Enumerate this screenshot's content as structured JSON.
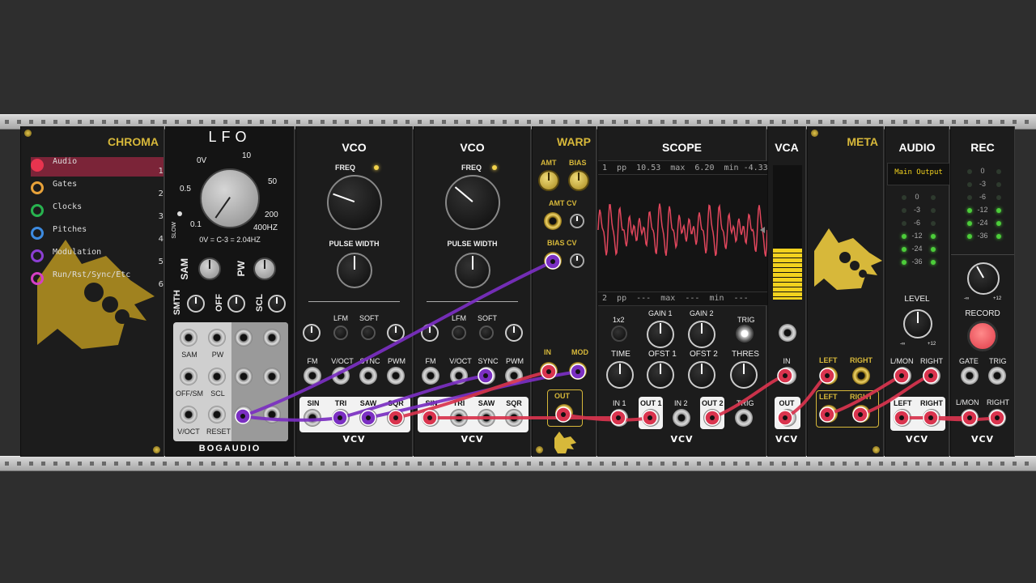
{
  "chroma": {
    "title": "CHROMA",
    "items": [
      {
        "name": "Audio",
        "num": "1",
        "color": "#e8344f"
      },
      {
        "name": "Gates",
        "num": "2",
        "color": "#e8a23a"
      },
      {
        "name": "Clocks",
        "num": "3",
        "color": "#28b34f"
      },
      {
        "name": "Pitches",
        "num": "4",
        "color": "#3d8be0"
      },
      {
        "name": "Modulation",
        "num": "5",
        "color": "#8c3fd3"
      },
      {
        "name": "Run/Rst/Sync/Etc",
        "num": "6",
        "color": "#d63fc4"
      }
    ]
  },
  "lfo": {
    "title": "LFO",
    "freq_labels": [
      "0V",
      "10",
      "0.5",
      "50",
      "0.1",
      "200",
      "400HZ"
    ],
    "slow": "SLOW",
    "note": "0V = C-3 = 2.04HZ",
    "knobs": [
      "SAM",
      "PW",
      "SMTH",
      "OFF",
      "SCL"
    ],
    "jack_labels": [
      "SAM",
      "PW",
      "OFF/SM",
      "SCL",
      "V/OCT",
      "RESET"
    ],
    "brand": "BOGAUDIO"
  },
  "vco": {
    "title": "VCO",
    "freq": "FREQ",
    "pulse_width": "PULSE WIDTH",
    "lfm": "LFM",
    "soft": "SOFT",
    "inputs": [
      "FM",
      "V/OCT",
      "SYNC",
      "PWM"
    ],
    "outputs": [
      "SIN",
      "TRI",
      "SAW",
      "SQR"
    ],
    "brand": "VCV"
  },
  "warp": {
    "title": "WARP",
    "amt": "AMT",
    "bias": "BIAS",
    "amt_cv": "AMT CV",
    "bias_cv": "BIAS CV",
    "in": "IN",
    "mod": "MOD",
    "out": "OUT"
  },
  "scope": {
    "title": "SCOPE",
    "stats1": "1  pp  10.53  max  6.20  min -4.33",
    "stats2": "2  pp  ---  max  ---  min  ---",
    "controls": [
      "1x2",
      "GAIN 1",
      "GAIN 2",
      "TRIG"
    ],
    "controls2": [
      "TIME",
      "OFST 1",
      "OFST 2",
      "THRES"
    ],
    "jacks": [
      "IN 1",
      "OUT 1",
      "IN 2",
      "OUT 2",
      "TRIG"
    ],
    "brand": "VCV"
  },
  "vca": {
    "title": "VCA",
    "in": "IN",
    "out": "OUT",
    "brand": "VCV",
    "level": 0.38
  },
  "meta": {
    "title": "META",
    "left": "LEFT",
    "right": "RIGHT"
  },
  "audio": {
    "title": "AUDIO",
    "device": "Main Output",
    "meter_labels": [
      "0",
      "-3",
      "-6",
      "-12",
      "-24",
      "-36"
    ],
    "level": "LEVEL",
    "min": "-∞",
    "max": "+12",
    "inputs": [
      "L/MON",
      "RIGHT"
    ],
    "outputs": [
      "LEFT",
      "RIGHT"
    ],
    "brand": "VCV"
  },
  "rec": {
    "title": "REC",
    "meter_labels": [
      "0",
      "-3",
      "-6",
      "-12",
      "-24",
      "-36"
    ],
    "min": "-∞",
    "max": "+12",
    "record": "RECORD",
    "gate": "GATE",
    "trig": "TRIG",
    "inputs": [
      "L/MON",
      "RIGHT"
    ],
    "brand": "VCV"
  },
  "colors": {
    "audio_cable": "#d9344e",
    "mod_cable": "#7b2fc2",
    "brand_gold": "#d7b83a"
  }
}
